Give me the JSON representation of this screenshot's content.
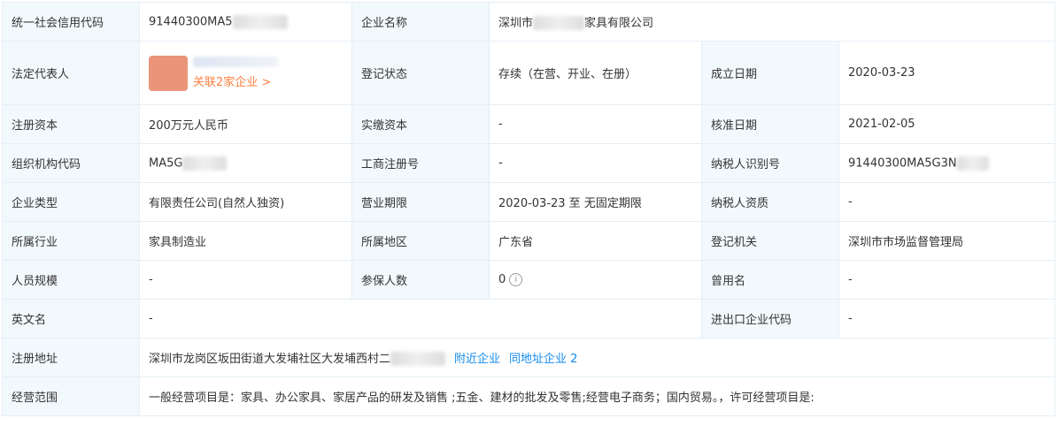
{
  "labels": {
    "credit_code": "统一社会信用代码",
    "company_name": "企业名称",
    "legal_rep": "法定代表人",
    "reg_status": "登记状态",
    "founded": "成立日期",
    "reg_capital": "注册资本",
    "paid_capital": "实缴资本",
    "approval_date": "核准日期",
    "org_code": "组织机构代码",
    "biz_reg_no": "工商注册号",
    "taxpayer_id": "纳税人识别号",
    "company_type": "企业类型",
    "biz_term": "营业期限",
    "taxpayer_qual": "纳税人资质",
    "industry": "所属行业",
    "region": "所属地区",
    "reg_authority": "登记机关",
    "staff_size": "人员规模",
    "insured_count": "参保人数",
    "former_name": "曾用名",
    "english_name": "英文名",
    "import_export_code": "进出口企业代码",
    "reg_address": "注册地址",
    "biz_scope": "经营范围"
  },
  "values": {
    "credit_code": "91440300MA5",
    "company_name_prefix": "深圳市",
    "company_name_suffix": "家具有限公司",
    "legal_rep_link": "关联2家企业 >",
    "reg_status": "存续（在营、开业、在册）",
    "founded": "2020-03-23",
    "reg_capital": "200万元人民币",
    "paid_capital": "-",
    "approval_date": "2021-02-05",
    "org_code": "MA5G",
    "biz_reg_no": "-",
    "taxpayer_id": "91440300MA5G3N",
    "company_type": "有限责任公司(自然人独资)",
    "biz_term": "2020-03-23 至 无固定期限",
    "taxpayer_qual": "-",
    "industry": "家具制造业",
    "region": "广东省",
    "reg_authority": "深圳市市场监督管理局",
    "staff_size": "-",
    "insured_count": "0",
    "former_name": "-",
    "english_name": "-",
    "import_export_code": "-",
    "reg_address": "深圳市龙岗区坂田街道大发埔社区大发埔西村二",
    "nearby_link": "附近企业",
    "same_address_link": "同地址企业 2",
    "biz_scope": "一般经营项目是：家具、办公家具、家居产品的研发及销售 ;五金、建材的批发及零售;经营电子商务；国内贸易。，许可经营项目是:"
  },
  "colors": {
    "label_bg": "#f2f9fc",
    "border": "#e4eef6",
    "link_blue": "#128bed",
    "link_orange": "#fd7f3f",
    "avatar": "#e88a6a"
  },
  "icons": {
    "insured_info": "info-circle-icon"
  }
}
